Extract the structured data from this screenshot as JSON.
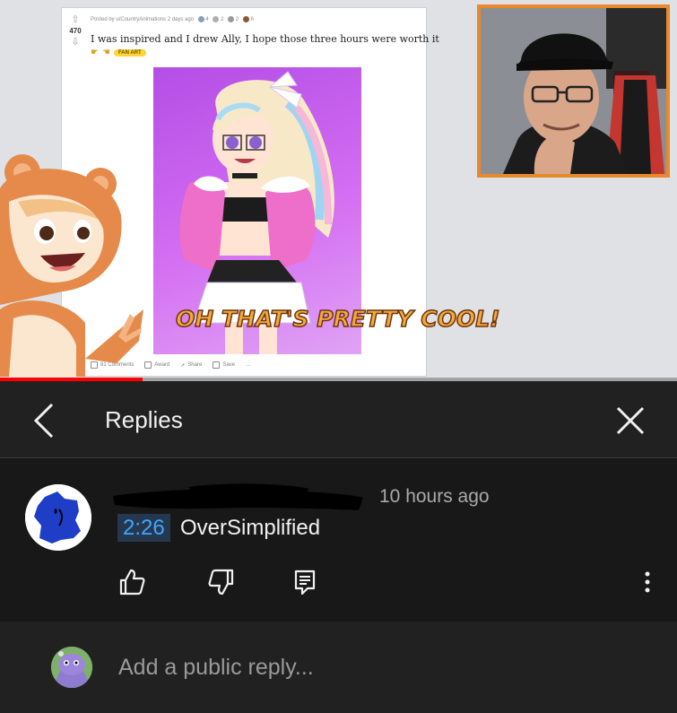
{
  "video": {
    "reddit_post": {
      "score": "470",
      "meta": "Posted by u/CountryAnimations 2 days ago",
      "award_counts": [
        "4",
        "2",
        "2",
        "6"
      ],
      "title": "I was inspired and I drew Ally, I hope those three hours were worth it",
      "flair": "FAN ART",
      "actions": {
        "comments": "81 Comments",
        "award": "Award",
        "share": "Share",
        "save": "Save",
        "more": "…"
      }
    },
    "caption": "OH THAT'S PRETTY COOL!",
    "progress": 0.21
  },
  "replies_panel": {
    "title": "Replies",
    "back_icon": "chevron-left-icon",
    "close_icon": "close-icon"
  },
  "comment": {
    "author": "",
    "time": "10 hours ago",
    "timestamp_link": "2:26",
    "text": "OverSimplified",
    "icons": [
      "thumb-up-icon",
      "thumb-down-icon",
      "reply-icon",
      "more-vert-icon"
    ]
  },
  "reply_bar": {
    "placeholder": "Add a public reply..."
  },
  "colors": {
    "link": "#3ea6ff",
    "progress": "#ff0000",
    "webcam_border": "#e88a2c",
    "caption": "#f6a93a"
  }
}
